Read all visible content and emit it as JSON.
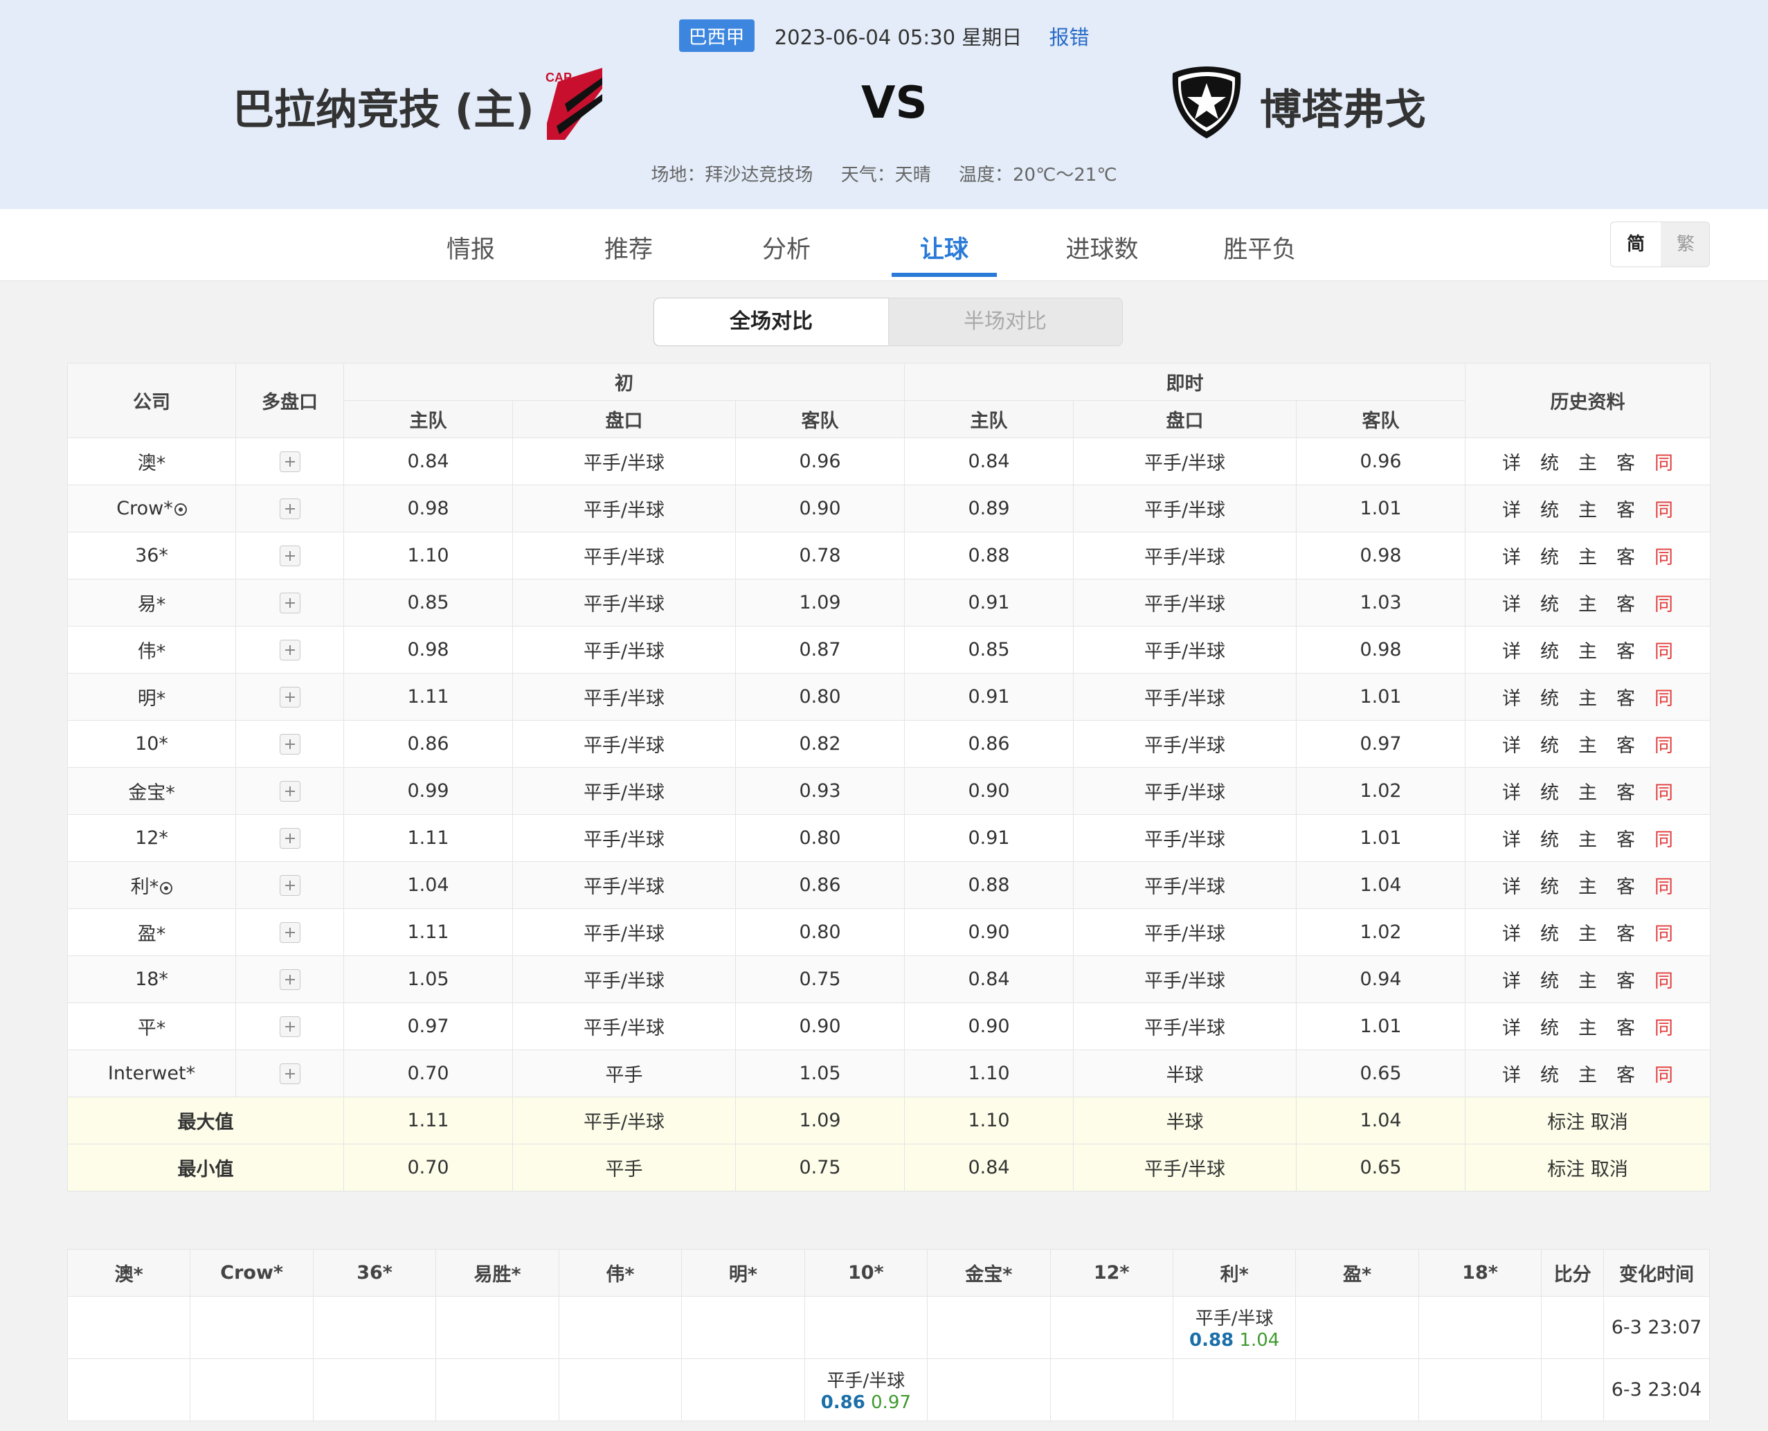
{
  "header": {
    "league": "巴西甲",
    "datetime": "2023-06-04 05:30 星期日",
    "report": "报错",
    "home_team": "巴拉纳竞技 (主)",
    "away_team": "博塔弗戈",
    "vs": "VS",
    "venue": "场地：拜沙达竞技场",
    "weather": "天气：天晴",
    "temperature": "温度：20℃～21℃",
    "home_logo_text": "CAP"
  },
  "nav": {
    "tabs": [
      "情报",
      "推荐",
      "分析",
      "让球",
      "进球数",
      "胜平负"
    ],
    "active_index": 3,
    "lang": [
      "简",
      "繁"
    ]
  },
  "segment": {
    "active": "全场对比",
    "inactive": "半场对比"
  },
  "odds_table": {
    "headers": {
      "company": "公司",
      "multi": "多盘口",
      "initial": "初",
      "live": "即时",
      "history": "历史资料",
      "home": "主队",
      "line": "盘口",
      "away": "客队"
    },
    "history_links": [
      "详",
      "统",
      "主",
      "客",
      "同"
    ],
    "rows": [
      {
        "company": "澳*",
        "ball": false,
        "i_home": "0.84",
        "i_line": "平手/半球",
        "i_away": "0.96",
        "l_home": "0.84",
        "l_line": "平手/半球",
        "l_away": "0.96"
      },
      {
        "company": "Crow*",
        "ball": true,
        "i_home": "0.98",
        "i_line": "平手/半球",
        "i_away": "0.90",
        "l_home": "0.89",
        "l_line": "平手/半球",
        "l_away": "1.01"
      },
      {
        "company": "36*",
        "ball": false,
        "i_home": "1.10",
        "i_line": "平手/半球",
        "i_away": "0.78",
        "l_home": "0.88",
        "l_line": "平手/半球",
        "l_away": "0.98"
      },
      {
        "company": "易*",
        "ball": false,
        "i_home": "0.85",
        "i_line": "平手/半球",
        "i_away": "1.09",
        "l_home": "0.91",
        "l_line": "平手/半球",
        "l_away": "1.03"
      },
      {
        "company": "伟*",
        "ball": false,
        "i_home": "0.98",
        "i_line": "平手/半球",
        "i_away": "0.87",
        "l_home": "0.85",
        "l_line": "平手/半球",
        "l_away": "0.98"
      },
      {
        "company": "明*",
        "ball": false,
        "i_home": "1.11",
        "i_line": "平手/半球",
        "i_away": "0.80",
        "l_home": "0.91",
        "l_line": "平手/半球",
        "l_away": "1.01"
      },
      {
        "company": "10*",
        "ball": false,
        "i_home": "0.86",
        "i_line": "平手/半球",
        "i_away": "0.82",
        "l_home": "0.86",
        "l_line": "平手/半球",
        "l_away": "0.97"
      },
      {
        "company": "金宝*",
        "ball": false,
        "i_home": "0.99",
        "i_line": "平手/半球",
        "i_away": "0.93",
        "l_home": "0.90",
        "l_line": "平手/半球",
        "l_away": "1.02"
      },
      {
        "company": "12*",
        "ball": false,
        "i_home": "1.11",
        "i_line": "平手/半球",
        "i_away": "0.80",
        "l_home": "0.91",
        "l_line": "平手/半球",
        "l_away": "1.01"
      },
      {
        "company": "利*",
        "ball": true,
        "i_home": "1.04",
        "i_line": "平手/半球",
        "i_away": "0.86",
        "l_home": "0.88",
        "l_line": "平手/半球",
        "l_away": "1.04"
      },
      {
        "company": "盈*",
        "ball": false,
        "i_home": "1.11",
        "i_line": "平手/半球",
        "i_away": "0.80",
        "l_home": "0.90",
        "l_line": "平手/半球",
        "l_away": "1.02"
      },
      {
        "company": "18*",
        "ball": false,
        "i_home": "1.05",
        "i_line": "平手/半球",
        "i_away": "0.75",
        "l_home": "0.84",
        "l_line": "平手/半球",
        "l_away": "0.94"
      },
      {
        "company": "平*",
        "ball": false,
        "i_home": "0.97",
        "i_line": "平手/半球",
        "i_away": "0.90",
        "l_home": "0.90",
        "l_line": "平手/半球",
        "l_away": "1.01"
      },
      {
        "company": "Interwet*",
        "ball": false,
        "i_home": "0.70",
        "i_line": "平手",
        "i_away": "1.05",
        "l_home": "1.10",
        "l_line": "半球",
        "l_away": "0.65"
      }
    ],
    "summary": [
      {
        "label": "最大值",
        "i_home": "1.11",
        "i_line": "平手/半球",
        "i_away": "1.09",
        "l_home": "1.10",
        "l_line": "半球",
        "l_away": "1.04",
        "action": "标注 取消"
      },
      {
        "label": "最小值",
        "i_home": "0.70",
        "i_line": "平手",
        "i_away": "0.75",
        "l_home": "0.84",
        "l_line": "平手/半球",
        "l_away": "0.65",
        "action": "标注 取消"
      }
    ]
  },
  "change_table": {
    "headers": [
      "澳*",
      "Crow*",
      "36*",
      "易胜*",
      "伟*",
      "明*",
      "10*",
      "金宝*",
      "12*",
      "利*",
      "盈*",
      "18*",
      "比分",
      "变化时间"
    ],
    "rows": [
      {
        "col": 9,
        "line": "平手/半球",
        "v1": "0.88",
        "v2": "1.04",
        "score": "",
        "time": "6-3 23:07"
      },
      {
        "col": 6,
        "line": "平手/半球",
        "v1": "0.86",
        "v2": "0.97",
        "score": "",
        "time": "6-3 23:04"
      }
    ]
  }
}
